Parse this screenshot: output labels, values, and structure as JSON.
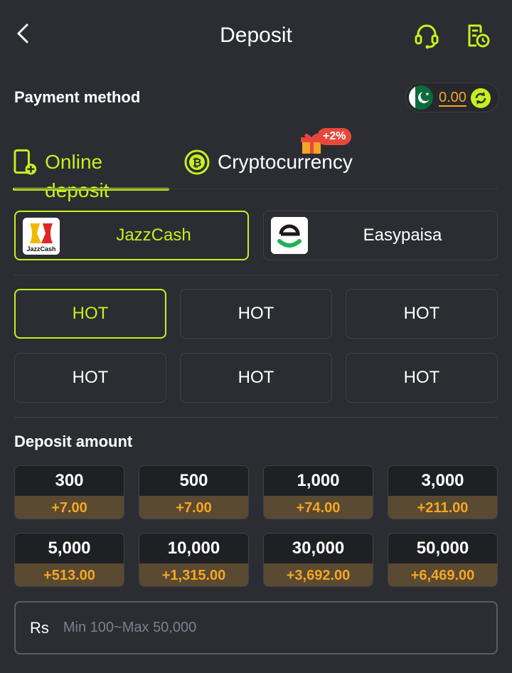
{
  "header": {
    "title": "Deposit"
  },
  "payment_method": {
    "label": "Payment method",
    "balance": "0.00"
  },
  "tabs": {
    "online_label": "Online deposit",
    "crypto_label": "Cryptocurrency",
    "crypto_bonus": "+2%"
  },
  "methods": [
    {
      "name": "JazzCash",
      "logo_text": "JazzCash",
      "active": true
    },
    {
      "name": "Easypaisa",
      "active": false
    }
  ],
  "channels": [
    "HOT",
    "HOT",
    "HOT",
    "HOT",
    "HOT",
    "HOT"
  ],
  "deposit_amount": {
    "label": "Deposit amount",
    "options": [
      {
        "amount": "300",
        "bonus": "+7.00"
      },
      {
        "amount": "500",
        "bonus": "+7.00"
      },
      {
        "amount": "1,000",
        "bonus": "+74.00"
      },
      {
        "amount": "3,000",
        "bonus": "+211.00"
      },
      {
        "amount": "5,000",
        "bonus": "+513.00"
      },
      {
        "amount": "10,000",
        "bonus": "+1,315.00"
      },
      {
        "amount": "30,000",
        "bonus": "+3,692.00"
      },
      {
        "amount": "50,000",
        "bonus": "+6,469.00"
      }
    ],
    "currency": "Rs",
    "placeholder": "Min 100~Max 50,000"
  },
  "colors": {
    "accent": "#c6f01e",
    "bonus": "#f5a623",
    "background": "#2b2d33"
  }
}
